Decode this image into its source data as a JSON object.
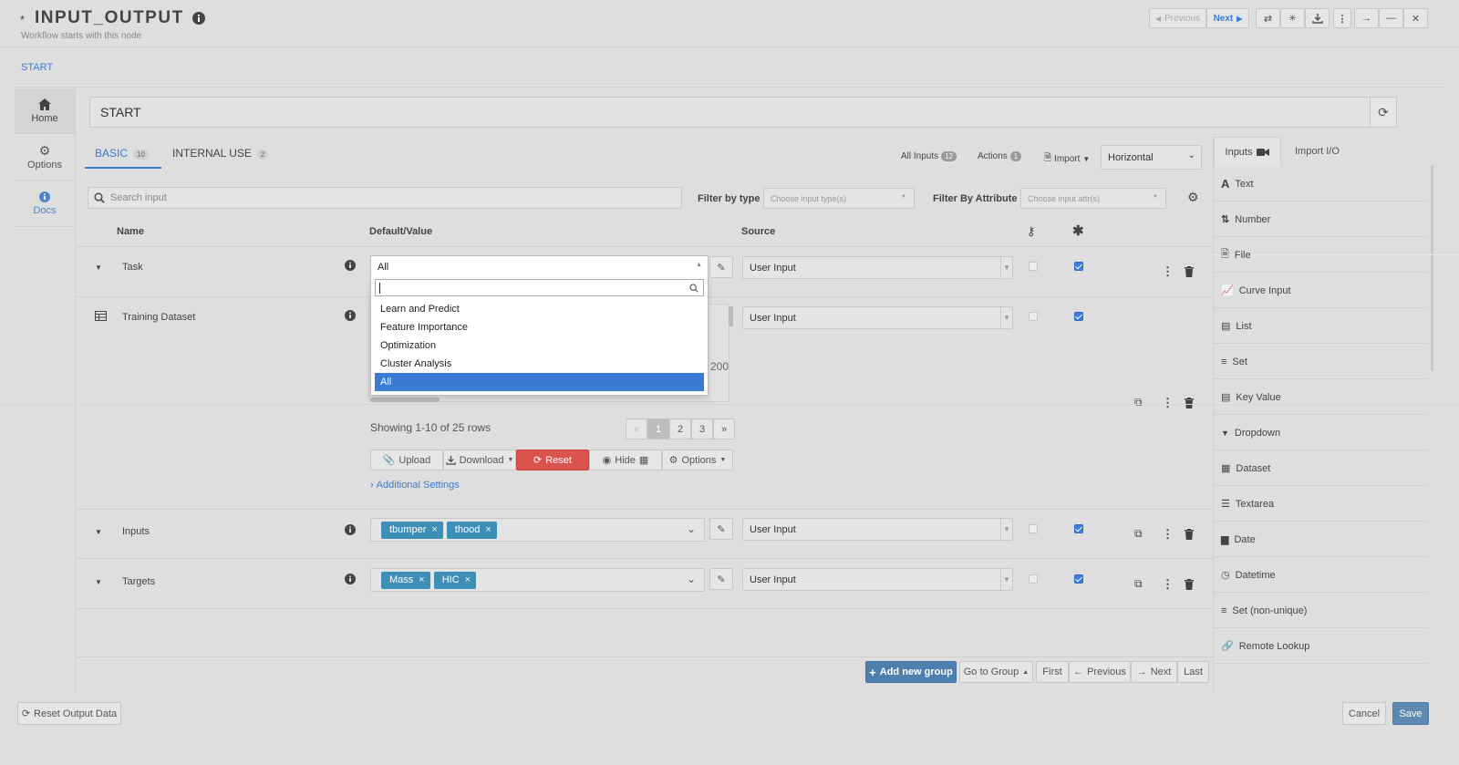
{
  "header": {
    "marker": "*",
    "title": "INPUT_OUTPUT",
    "subtitle": "Workflow starts with this node",
    "breadcrumb": "START",
    "prev_label": "Previous",
    "next_label": "Next"
  },
  "left_nav": {
    "items": [
      {
        "label": "Home",
        "icon": "home-icon"
      },
      {
        "label": "Options",
        "icon": "gear-icon"
      },
      {
        "label": "Docs",
        "icon": "info-icon"
      }
    ]
  },
  "node_name": "START",
  "tabs": {
    "basic_label": "BASIC",
    "basic_count": "10",
    "internal_label": "INTERNAL USE",
    "internal_count": "2"
  },
  "toolbar": {
    "all_inputs_label": "All Inputs",
    "all_inputs_count": "12",
    "actions_label": "Actions",
    "actions_count": "1",
    "import_label": "Import",
    "layout_value": "Horizontal"
  },
  "filters": {
    "search_placeholder": "Search input",
    "filter_type_label": "Filter by type",
    "filter_type_placeholder": "Choose input type(s)",
    "filter_attr_label": "Filter By Attribute",
    "filter_attr_placeholder": "Choose input attr(s)"
  },
  "columns": {
    "name": "Name",
    "value": "Default/Value",
    "source": "Source"
  },
  "rows": {
    "task": {
      "name": "Task",
      "value": "All",
      "source": "User Input"
    },
    "training": {
      "name": "Training Dataset",
      "source": "User Input",
      "partial_cell": "200"
    },
    "inputs": {
      "name": "Inputs",
      "tags": [
        "tbumper",
        "thood"
      ],
      "source": "User Input"
    },
    "targets": {
      "name": "Targets",
      "tags": [
        "Mass",
        "HIC"
      ],
      "source": "User Input"
    }
  },
  "dropdown": {
    "options": [
      "Learn and Predict",
      "Feature Importance",
      "Optimization",
      "Cluster Analysis",
      "All"
    ],
    "selected": "All"
  },
  "dataset": {
    "showing": "Showing 1-10 of 25 rows",
    "pages": [
      "«",
      "1",
      "2",
      "3",
      "»"
    ],
    "current_page": "1",
    "upload": "Upload",
    "download": "Download",
    "reset": "Reset",
    "hide": "Hide",
    "options": "Options",
    "additional": "Additional Settings"
  },
  "footer_nav": {
    "add_group": "Add new group",
    "go_to_group": "Go to Group",
    "first": "First",
    "previous": "Previous",
    "next": "Next",
    "last": "Last"
  },
  "right_panel": {
    "tab_inputs": "Inputs",
    "tab_import": "Import I/O",
    "items": [
      "Text",
      "Number",
      "File",
      "Curve Input",
      "List",
      "Set",
      "Key Value",
      "Dropdown",
      "Dataset",
      "Textarea",
      "Date",
      "Datetime",
      "Set (non-unique)",
      "Remote Lookup"
    ]
  },
  "bottom": {
    "reset_output": "Reset Output Data",
    "cancel": "Cancel",
    "save": "Save"
  },
  "colors": {
    "accent": "#3a7bd5",
    "tag": "#3e8fb8",
    "reset": "#d9534f",
    "add_group": "#4f7fae",
    "save": "#5d89b3"
  }
}
